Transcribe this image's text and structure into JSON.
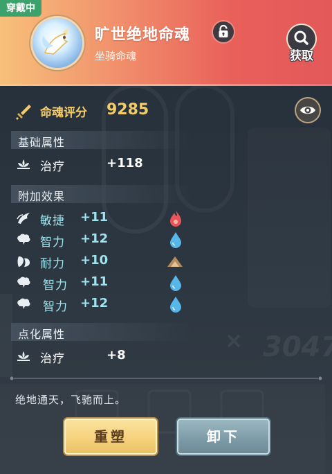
{
  "header": {
    "equipped_badge": "穿戴中",
    "title": "旷世绝地命魂",
    "subtitle": "坐骑命魂",
    "obtain_label": "获取"
  },
  "score": {
    "label": "命魂评分",
    "value": "9285"
  },
  "base_section": {
    "title": "基础属性",
    "stats": [
      {
        "icon": "healing-lotus-icon",
        "name": "治疗",
        "value": "+118"
      }
    ]
  },
  "extra_section": {
    "title": "附加效果",
    "stats": [
      {
        "icon": "agility-wing-icon",
        "name": "敏捷",
        "value": "+11",
        "gem": "fire-gem-icon",
        "gem_color": "#e8555a"
      },
      {
        "icon": "intellect-brain-icon",
        "name": "智力",
        "value": "+12",
        "gem": "water-gem-icon",
        "gem_color": "#56b7e8"
      },
      {
        "icon": "stamina-icon",
        "name": "耐力",
        "value": "+10",
        "gem": "earth-gem-icon",
        "gem_color": "#b98a5a"
      },
      {
        "icon": "intellect-brain-icon",
        "name": "智力",
        "value": "+11",
        "gem": "water-gem-icon",
        "gem_color": "#56b7e8"
      },
      {
        "icon": "intellect-brain-icon",
        "name": "智力",
        "value": "+12",
        "gem": "water-gem-icon",
        "gem_color": "#56b7e8"
      }
    ]
  },
  "refine_section": {
    "title": "点化属性",
    "stats": [
      {
        "icon": "healing-lotus-icon",
        "name": "治疗",
        "value": "+8"
      }
    ]
  },
  "background_number": "3047",
  "description": "绝地通天，飞驰而上。",
  "buttons": {
    "reshape": "重塑",
    "unequip": "卸下"
  },
  "colors": {
    "header_start": "#f7c07a",
    "header_end": "#e3585a",
    "score_gold": "#f4cd6a",
    "extra_cyan": "#9fe4ee",
    "badge_green": "#3aa26a"
  }
}
